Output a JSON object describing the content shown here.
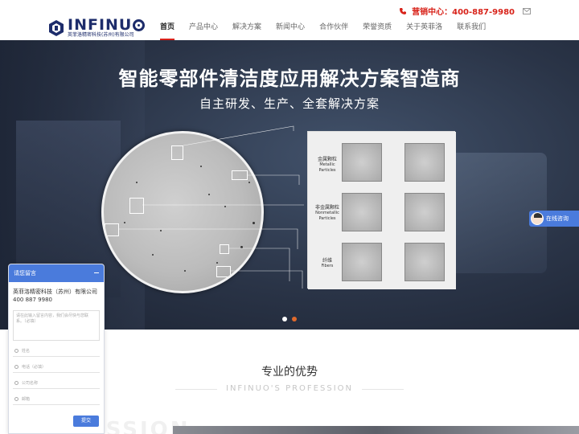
{
  "header": {
    "logo_name": "INFINU",
    "logo_sub": "英菲洛精密科技(苏州)有限公司",
    "hotline": "营销中心：400-887-9980",
    "nav": [
      {
        "label": "首页",
        "active": true
      },
      {
        "label": "产品中心"
      },
      {
        "label": "解决方案"
      },
      {
        "label": "新闻中心"
      },
      {
        "label": "合作伙伴"
      },
      {
        "label": "荣誉资质"
      },
      {
        "label": "关于英菲洛"
      },
      {
        "label": "联系我们"
      }
    ]
  },
  "banner": {
    "title": "智能零部件清洁度应用解决方案智造商",
    "subtitle": "自主研发、生产、全套解决方案",
    "panel_rows": [
      {
        "cn": "金属颗粒",
        "en": "Metallic Particles"
      },
      {
        "cn": "非金属颗粒",
        "en": "Nonmetallic Particles"
      },
      {
        "cn": "纤维",
        "en": "Fibers"
      }
    ],
    "slides": 2,
    "active_slide": 1
  },
  "section": {
    "title": "专业的优势",
    "subtitle_en": "INFINUO'S PROFESSION",
    "bg_letters": "PROFESSION"
  },
  "message": {
    "header": "请您留言",
    "company": "英菲洛精密科技（苏州）有限公司400 887 9980",
    "textarea_placeholder": "请在此输入留言内容，我们会尽快与您联系。（必填）",
    "fields": [
      "姓名",
      "电话（必填）",
      "公司名称",
      "邮箱"
    ],
    "submit": "提交"
  },
  "consult": {
    "label": "在线咨询"
  },
  "colors": {
    "brand": "#1d2c6b",
    "accent": "#d8231a",
    "widget": "#4a7bdc",
    "active_dot": "#e06a2c"
  }
}
